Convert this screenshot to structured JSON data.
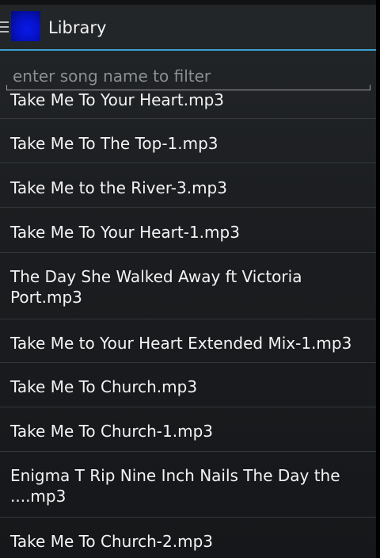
{
  "action_bar": {
    "title": "Library",
    "drawer_icon": "menu-icon",
    "app_icon": "app-logo-icon"
  },
  "filter": {
    "placeholder": "enter song name to filter",
    "value": ""
  },
  "songs": [
    "Take Me To Your Heart.mp3",
    "Take Me To The Top-1.mp3",
    "Take Me to the River-3.mp3",
    "Take Me To Your Heart-1.mp3",
    "The Day She Walked Away ft Victoria Port.mp3",
    "Take Me to Your Heart Extended Mix-1.mp3",
    "Take Me To Church.mp3",
    "Take Me To Church-1.mp3",
    "Enigma T Rip Nine Inch Nails The Day the ....mp3",
    "Take Me To Church-2.mp3"
  ],
  "colors": {
    "accent": "#3aa2cf",
    "background": "#1b1d20",
    "text": "#f4f4f4",
    "placeholder": "#8b8e92",
    "divider": "#34373b"
  }
}
